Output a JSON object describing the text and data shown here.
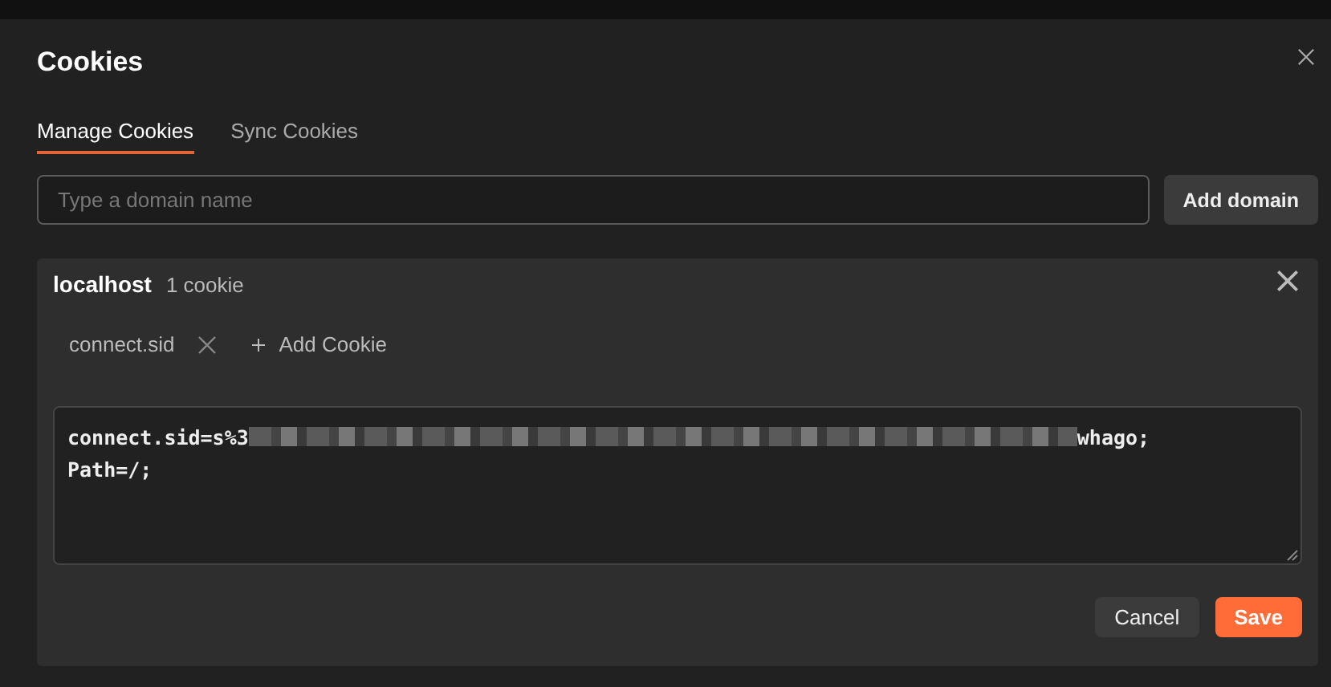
{
  "dialog": {
    "title": "Cookies"
  },
  "tabs": [
    {
      "label": "Manage Cookies",
      "selected": true
    },
    {
      "label": "Sync Cookies",
      "selected": false
    }
  ],
  "domain_field": {
    "placeholder": "Type a domain name"
  },
  "add_domain_button": "Add domain",
  "domain": {
    "name": "localhost",
    "count": "1 cookie",
    "cookies": [
      {
        "name": "connect.sid"
      }
    ],
    "add_cookie": "Add Cookie",
    "value_lines": [
      {
        "start": "connect.sid=s%3",
        "redacted": true,
        "end": "whago;"
      },
      {
        "start": "Path=/;",
        "redacted": false
      }
    ],
    "buttons": [
      {
        "label": "Cancel",
        "kind": "secondary"
      },
      {
        "label": "Save",
        "kind": "primary"
      }
    ]
  }
}
